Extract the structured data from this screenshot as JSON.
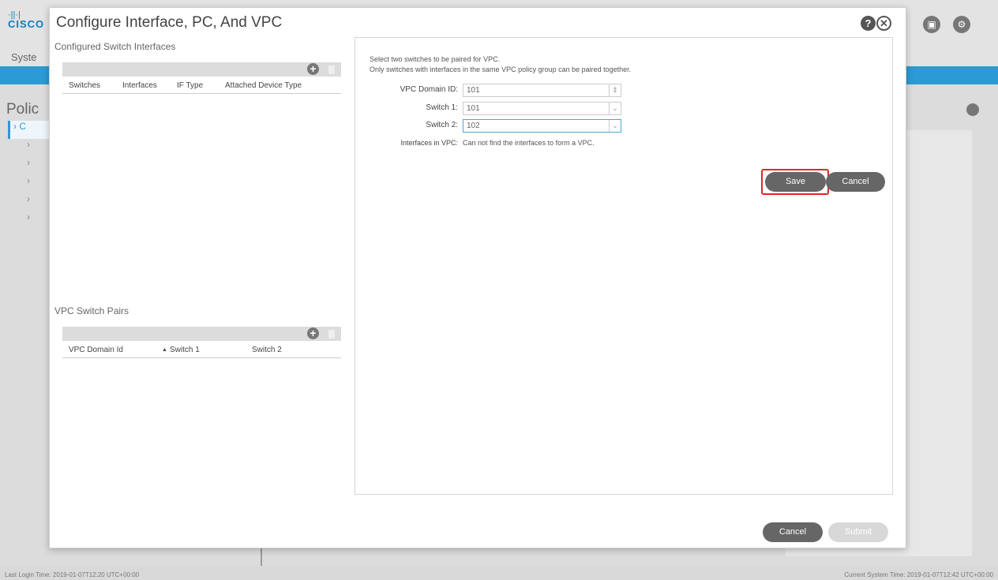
{
  "background": {
    "logo_text": "CISCO",
    "nav_label": "Syste",
    "section_title": "Polic",
    "tree_first": "› C",
    "tree_items": [
      "›",
      "›",
      "›",
      "›",
      "›"
    ],
    "right_panel_fragment": ")",
    "footer_left": "Last Login Time: 2019-01-07T12:20 UTC+00:00",
    "footer_right": "Current System Time: 2019-01-07T12:42 UTC+00:00"
  },
  "modal": {
    "title": "Configure Interface, PC, And VPC",
    "help_icon": "?",
    "close_icon": "✕",
    "configured_switch_interfaces": {
      "label": "Configured Switch Interfaces",
      "columns": [
        "Switches",
        "Interfaces",
        "IF Type",
        "Attached Device Type"
      ]
    },
    "vpc_switch_pairs": {
      "label": "VPC Switch Pairs",
      "columns": [
        "VPC Domain Id",
        "Switch 1",
        "Switch 2"
      ],
      "sort_indicator": "▲"
    },
    "panel": {
      "message_line1": "Select two switches to be paired for VPC.",
      "message_line2": "Only switches with interfaces in the same VPC policy group can be paired together.",
      "vpc_domain_id_label": "VPC Domain ID:",
      "vpc_domain_id_value": "101",
      "switch1_label": "Switch 1:",
      "switch1_value": "101",
      "switch2_label": "Switch 2:",
      "switch2_value": "102",
      "interfaces_label": "Interfaces in VPC:",
      "interfaces_value": "Can not find the interfaces to form a VPC.",
      "save_label": "Save",
      "cancel_label": "Cancel"
    },
    "footer": {
      "cancel_label": "Cancel",
      "submit_label": "Submit"
    }
  },
  "colors": {
    "accent_blue": "#2c9ad3",
    "highlight_red": "#e0262b"
  }
}
